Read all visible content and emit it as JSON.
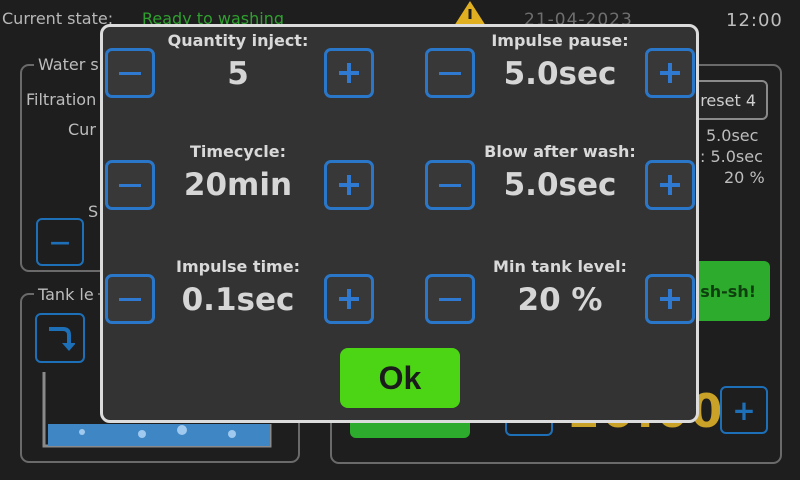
{
  "header": {
    "state_label": "Current state:",
    "state_value": "Ready to washing",
    "date": "21-04-2023",
    "time": "12:00",
    "warning_icon": "warning-triangle-icon"
  },
  "background": {
    "water_panel_title": "Water s",
    "filtration_label": "Filtration",
    "cur_label": "Cur",
    "s_label": "S",
    "tank_panel_title": "Tank le",
    "preset_label": "reset 4",
    "readouts": [
      "5.0sec",
      ": 5.0sec",
      "20 %"
    ],
    "wash_button_label": "sh-sh!",
    "big_value": "20:00",
    "tank_icon": "arrow-down-turn-icon"
  },
  "dialog": {
    "params": [
      {
        "label": "Quantity inject:",
        "value": "5"
      },
      {
        "label": "Impulse pause:",
        "value": "5.0sec"
      },
      {
        "label": "Timecycle:",
        "value": "20min"
      },
      {
        "label": "Blow after wash:",
        "value": "5.0sec"
      },
      {
        "label": "Impulse time:",
        "value": "0.1sec"
      },
      {
        "label": "Min tank level:",
        "value": "20 %"
      }
    ],
    "ok_label": "Ok"
  },
  "colors": {
    "accent_blue": "#2a77c9",
    "ok_green": "#4cd515",
    "status_green": "#2fa02f",
    "warning_yellow": "#e0b020",
    "value_orange": "#c9a227"
  }
}
